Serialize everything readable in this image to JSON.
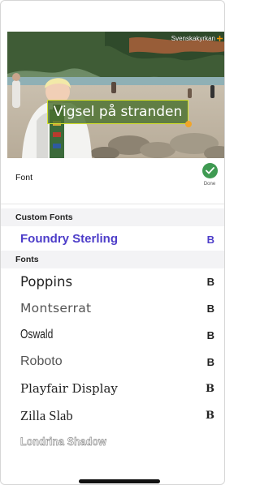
{
  "preview": {
    "watermark": "Svenskakyrkan",
    "caption": "Vigsel på stranden"
  },
  "font_header": {
    "label": "Font",
    "done_label": "Done",
    "accent": "#3f9a52"
  },
  "custom_fonts": {
    "heading": "Custom Fonts",
    "items": [
      {
        "name": "Foundry Sterling",
        "bold_label": "B",
        "selected": true
      }
    ]
  },
  "fonts": {
    "heading": "Fonts",
    "items": [
      {
        "name": "Poppins",
        "bold_label": "B"
      },
      {
        "name": "Montserrat",
        "bold_label": "B"
      },
      {
        "name": "Oswald",
        "bold_label": "B"
      },
      {
        "name": "Roboto",
        "bold_label": "B"
      },
      {
        "name": "Playfair Display",
        "bold_label": "B"
      },
      {
        "name": "Zilla Slab",
        "bold_label": "B"
      },
      {
        "name": "Londrina Shadow"
      }
    ]
  },
  "colors": {
    "selected": "#4d3dc9",
    "caption_bg": "#4a702e",
    "caption_border": "#d6e22c",
    "caption_handle": "#f1a52a"
  }
}
